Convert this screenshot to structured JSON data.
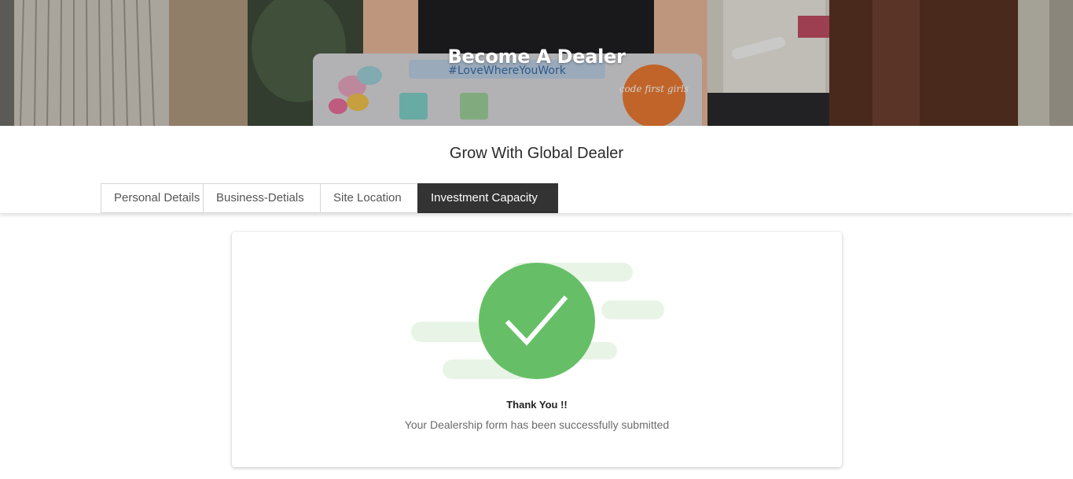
{
  "hero": {
    "title": "Become A Dealer",
    "laptop_sticker_text": "#LoveWhereYouWork",
    "round_sticker_text": "code first girls"
  },
  "section": {
    "subtitle": "Grow With Global Dealer"
  },
  "tabs": [
    {
      "label": "Personal Details",
      "active": false
    },
    {
      "label": "Business-Detials",
      "active": false
    },
    {
      "label": "Site Location",
      "active": false
    },
    {
      "label": "Investment Capacity",
      "active": true
    }
  ],
  "success": {
    "heading": "Thank You !!",
    "message": "Your Dealership form has been successfully submitted",
    "icon": "check-circle-icon"
  },
  "colors": {
    "accent_green": "#66bf67",
    "active_tab_bg": "#333333",
    "blob_green": "#e8f5e6"
  }
}
